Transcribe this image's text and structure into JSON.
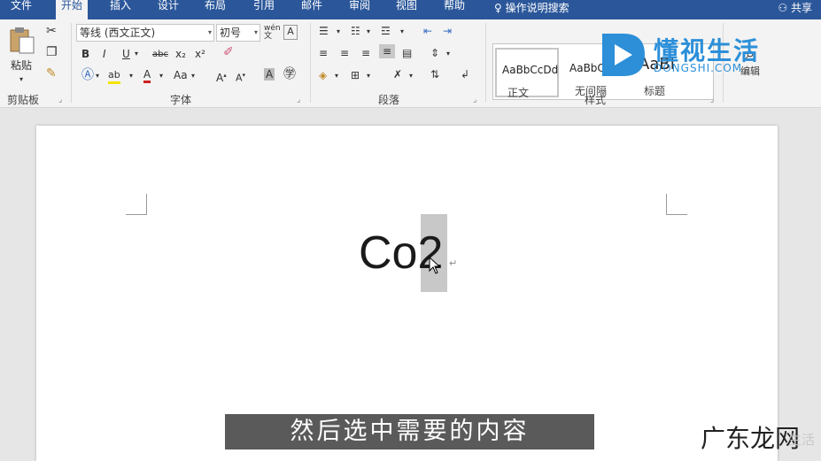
{
  "tabs": [
    "文件",
    "开始",
    "插入",
    "设计",
    "布局",
    "引用",
    "邮件",
    "审阅",
    "视图",
    "帮助"
  ],
  "tell_me": "操作说明搜索",
  "share": "共享",
  "clipboard": {
    "paste_label": "粘贴",
    "group_label": "剪贴板"
  },
  "font": {
    "font_name": "等线 (西文正文)",
    "font_size": "初号",
    "wen_label": "wén\n文",
    "group_label": "字体",
    "aa_label": "Aa",
    "a_label": "A"
  },
  "paragraph": {
    "group_label": "段落"
  },
  "styles": {
    "group_label": "样式",
    "items": [
      {
        "sample": "AaBbCcDd",
        "name": "正文"
      },
      {
        "sample": "AaBbCcDd",
        "name": "无间隔"
      },
      {
        "sample": "AaBl",
        "name": "标题"
      }
    ]
  },
  "editing": {
    "label": "编辑"
  },
  "watermark": {
    "brand": "懂视生活",
    "domain": "DONGSHI.COM",
    "bottom_text": "广东龙网",
    "bottom_faint": "生活"
  },
  "document": {
    "text": "Co2",
    "para_mark": "↵"
  },
  "subtitle": "然后选中需要的内容",
  "colors": {
    "title_bar": "#2b579a",
    "accent": "#2b579a",
    "highlight": "#c8c8c8",
    "logo": "#2c8fd8"
  }
}
